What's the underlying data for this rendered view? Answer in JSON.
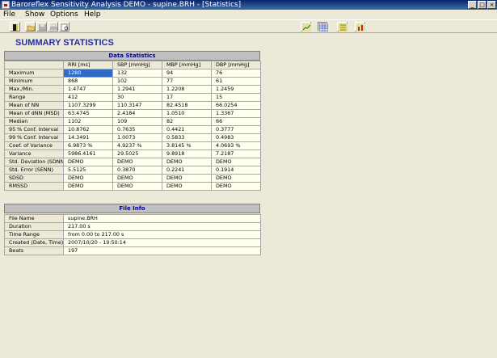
{
  "window": {
    "title": "Baroreflex Sensitivity Analysis DEMO - supine.BRH - [Statistics]"
  },
  "menu": [
    "File",
    "Show",
    "Options",
    "Help"
  ],
  "toolbar": {
    "left": [
      "open-folder-icon",
      "save-icon",
      "print-icon",
      "print-preview-icon"
    ],
    "right": [
      "line-chart-view-icon",
      "statistics-view-icon",
      "grid-view-icon",
      "bar-chart-view-icon"
    ]
  },
  "summary_title": "SUMMARY STATISTICS",
  "data_statistics": {
    "title": "Data Statistics",
    "columns": [
      "RRI [ms]",
      "SBP [mmHg]",
      "MBP [mmHg]",
      "DBP [mmHg]"
    ],
    "rows": [
      {
        "label": "Maximum",
        "values": [
          "1280",
          "132",
          "94",
          "76"
        ]
      },
      {
        "label": "Minimum",
        "values": [
          "868",
          "102",
          "77",
          "61"
        ]
      },
      {
        "label": "Max./Min.",
        "values": [
          "1.4747",
          "1.2941",
          "1.2208",
          "1.2459"
        ]
      },
      {
        "label": "Range",
        "values": [
          "412",
          "30",
          "17",
          "15"
        ]
      },
      {
        "label": "Mean of NN",
        "values": [
          "1107.3299",
          "110.3147",
          "82.4518",
          "66.0254"
        ]
      },
      {
        "label": "Mean of dNN (MSD)",
        "values": [
          "63.4745",
          "2.4184",
          "1.0510",
          "1.3367"
        ]
      },
      {
        "label": "Median",
        "values": [
          "1102",
          "109",
          "82",
          "66"
        ]
      },
      {
        "label": "95 % Conf. Interval",
        "values": [
          "10.8762",
          "0.7635",
          "0.4421",
          "0.3777"
        ]
      },
      {
        "label": "99 % Conf. Interval",
        "values": [
          "14.3491",
          "1.0073",
          "0.5833",
          "0.4983"
        ]
      },
      {
        "label": "Coef. of Variance",
        "values": [
          "6.9873 %",
          "4.9237 %",
          "3.8145 %",
          "4.0693 %"
        ]
      },
      {
        "label": "Variance",
        "values": [
          "5986.4161",
          "29.5025",
          "9.8918",
          "7.2187"
        ]
      },
      {
        "label": "Std. Deviation (SDNN)",
        "values": [
          "DEMO",
          "DEMO",
          "DEMO",
          "DEMO"
        ]
      },
      {
        "label": "Std. Error (SENN)",
        "values": [
          "5.5125",
          "0.3870",
          "0.2241",
          "0.1914"
        ]
      },
      {
        "label": "SDSD",
        "values": [
          "DEMO",
          "DEMO",
          "DEMO",
          "DEMO"
        ]
      },
      {
        "label": "RMSSD",
        "values": [
          "DEMO",
          "DEMO",
          "DEMO",
          "DEMO"
        ]
      }
    ]
  },
  "file_info": {
    "title": "File Info",
    "rows": [
      {
        "label": "File Name",
        "value": "supine.BRH"
      },
      {
        "label": "Duration",
        "value": "217.00  s"
      },
      {
        "label": "Time Range",
        "value": "from 0.00 to 217.00  s"
      },
      {
        "label": "Created (Date, Time)",
        "value": "2007/10/20  -  19:50:14"
      },
      {
        "label": "Beats",
        "value": "197"
      }
    ]
  },
  "colors": {
    "title_accent": "#2030b0",
    "selection": "#316ac5",
    "cell_bg": "#fffff0"
  }
}
